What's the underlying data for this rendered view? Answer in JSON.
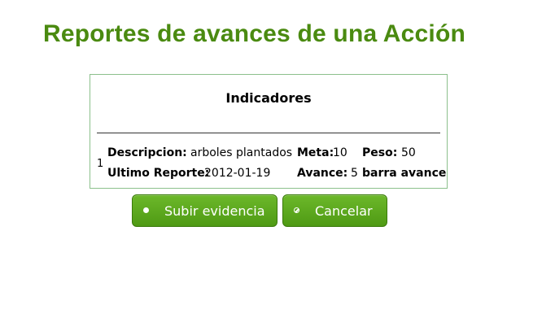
{
  "page": {
    "title": "Reportes de avances de una Acción"
  },
  "panel": {
    "heading": "Indicadores",
    "row": {
      "index": "1",
      "descripcion_label": "Descripcion:",
      "descripcion_value": "arboles plantados",
      "meta_label": "Meta:",
      "meta_value": "10",
      "peso_label": "Peso:",
      "peso_value": "50",
      "ultimo_reporte_label": "Ultimo Reporte:",
      "ultimo_reporte_value": "2012-01-19",
      "avance_label": "Avance:",
      "avance_value": "5",
      "barra_avance_label": "barra avance"
    }
  },
  "actions": {
    "upload_label": "Subir evidencia",
    "cancel_label": "Cancelar"
  },
  "colors": {
    "title": "#4a8a10",
    "button": "#5aa81c",
    "panel_border": "#8cc08c"
  },
  "icons": {
    "upload": "dot-icon",
    "cancel": "cancel-icon"
  }
}
